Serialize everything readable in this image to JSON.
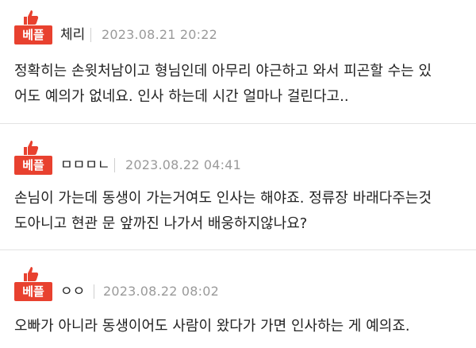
{
  "comments": [
    {
      "badge": "베플",
      "author": "체리",
      "date": "2023.08.21 20:22",
      "lines": [
        "정확히는 손윗처남이고 형님인데 아무리 야근하고 와서 피곤할 수는 있",
        "어도 예의가 없네요. 인사 하는데 시간 얼마나 걸린다고.."
      ]
    },
    {
      "badge": "베플",
      "author": "ㅁㅁㅁㄴ",
      "date": "2023.08.22 04:41",
      "lines": [
        "손님이 가는데 동생이 가는거여도 인사는 해야죠. 정류장 바래다주는것",
        "도아니고 현관 문 앞까진 나가서 배웅하지않나요?"
      ]
    },
    {
      "badge": "베플",
      "author": "ㅇㅇ",
      "date": "2023.08.22 08:02",
      "lines": [
        "오빠가 아니라 동생이어도 사람이 왔다가 가면 인사하는 게 예의죠."
      ]
    }
  ],
  "icons": {
    "badge_icon": "thumbs-up-icon"
  },
  "colors": {
    "badge": "#e8412f",
    "date": "#9a9a9a",
    "divider": "#e3e3e3"
  }
}
